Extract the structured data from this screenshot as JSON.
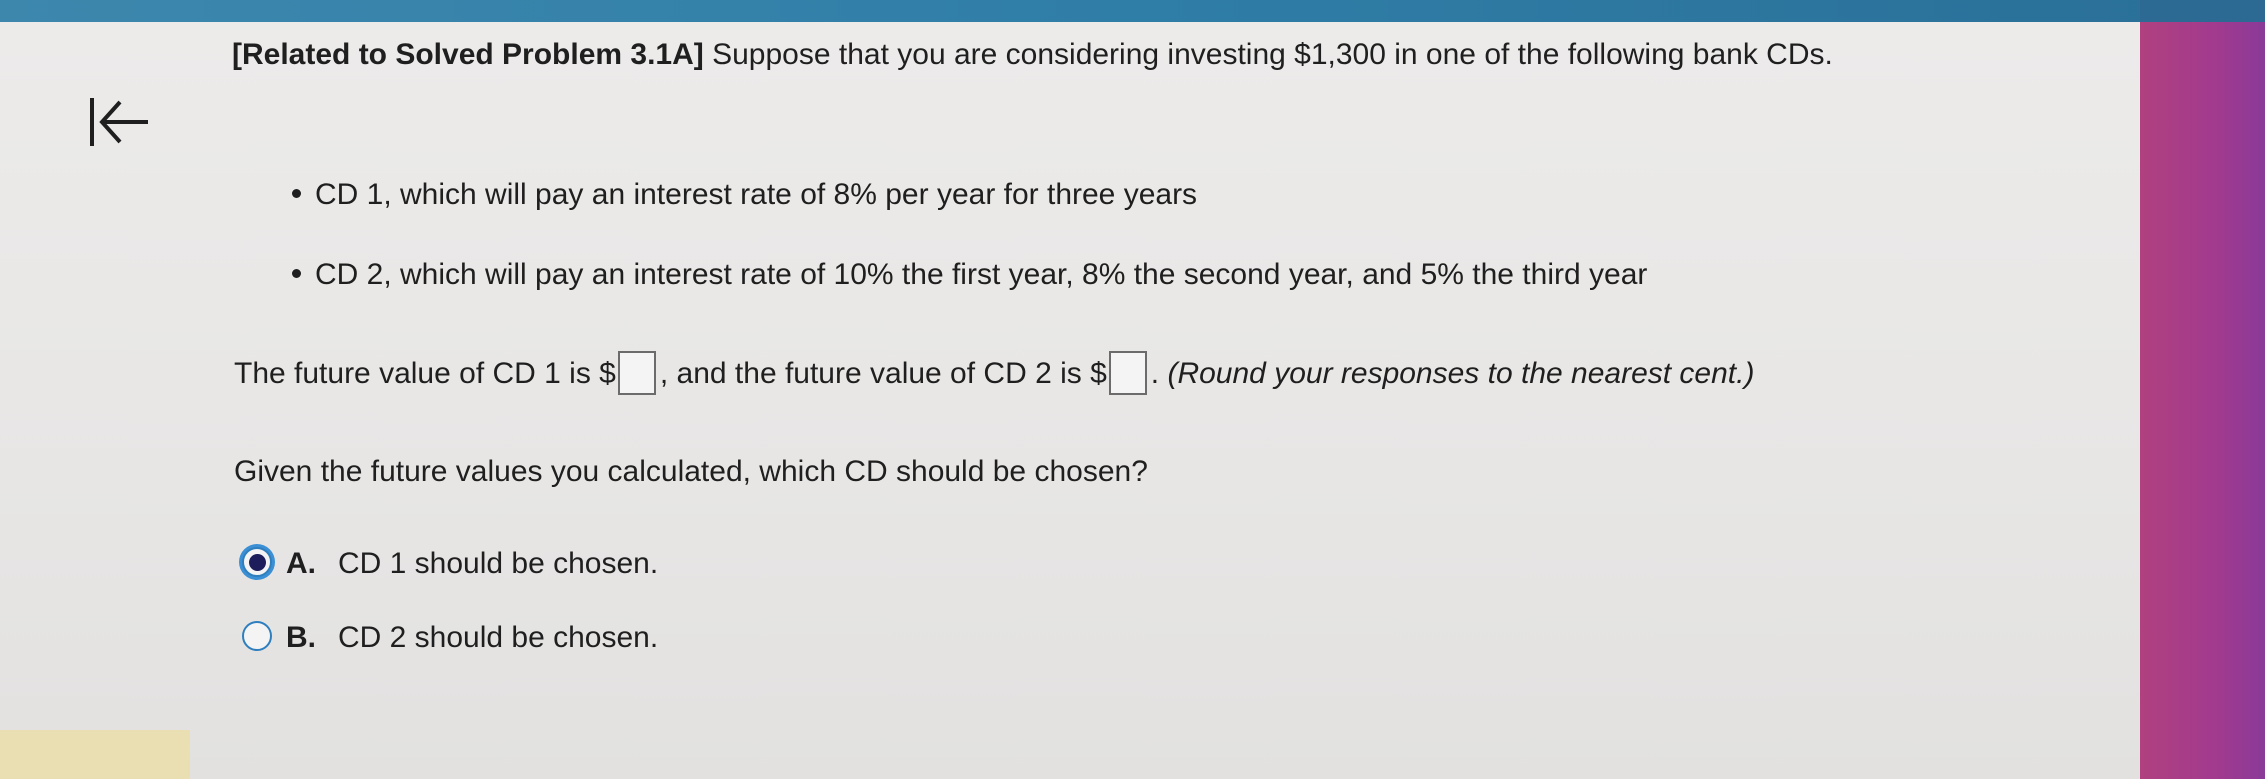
{
  "problem": {
    "reference": "[Related to Solved Problem 3.1A]",
    "intro": " Suppose that you are considering investing $1,300 in one of the following bank CDs."
  },
  "bullets": [
    "CD 1, which will pay an interest rate of 8% per year for three years",
    "CD 2, which will pay an interest rate of 10% the first year, 8% the second year, and 5% the third year"
  ],
  "future_value": {
    "part1": "The future value of CD 1 is $",
    "part2": ", and the future value of CD 2 is $",
    "part3": ". ",
    "round_note": "(Round your responses to the nearest cent.)",
    "cd1_value": "",
    "cd2_value": ""
  },
  "question": "Given the future values you calculated, which CD should be chosen?",
  "options": [
    {
      "letter": "A.",
      "text": "CD 1 should be chosen.",
      "selected": true
    },
    {
      "letter": "B.",
      "text": "CD 2 should be chosen.",
      "selected": false
    }
  ],
  "icons": {
    "back": "back-to-start-icon"
  },
  "colors": {
    "top_bar": "#2f7ea8",
    "radio_border": "#2f7fbf",
    "radio_fill": "#1d1d5c",
    "right_strip": "#a23a8e"
  }
}
